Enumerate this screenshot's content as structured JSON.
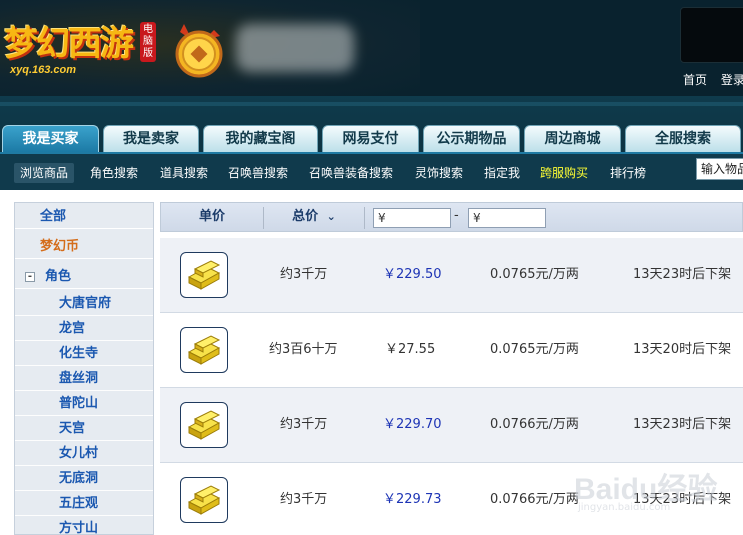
{
  "header": {
    "logo_main": "梦幻西游",
    "logo_tag": "电脑版",
    "logo_url": "xyq.163.com",
    "top_links": [
      "首页",
      "登录"
    ]
  },
  "main_tabs": [
    {
      "label": "我是买家",
      "active": true
    },
    {
      "label": "我是卖家",
      "active": false
    },
    {
      "label": "我的藏宝阁",
      "active": false
    },
    {
      "label": "网易支付",
      "active": false
    },
    {
      "label": "公示期物品",
      "active": false
    },
    {
      "label": "周边商城",
      "active": false
    },
    {
      "label": "全服搜索",
      "active": false
    }
  ],
  "sub_nav": [
    {
      "label": "浏览商品",
      "active": true
    },
    {
      "label": "角色搜索"
    },
    {
      "label": "道具搜索"
    },
    {
      "label": "召唤兽搜索"
    },
    {
      "label": "召唤兽装备搜索"
    },
    {
      "label": "灵饰搜索"
    },
    {
      "label": "指定我"
    },
    {
      "label": "跨服购买",
      "highlight": true
    },
    {
      "label": "排行榜"
    }
  ],
  "sub_search_placeholder": "输入物品",
  "sidebar": {
    "items": [
      "全部",
      "梦幻币"
    ],
    "category": "角色",
    "schools": [
      "大唐官府",
      "龙宫",
      "化生寺",
      "盘丝洞",
      "普陀山",
      "天宫",
      "女儿村",
      "无底洞",
      "五庄观",
      "方寸山"
    ]
  },
  "list_header": {
    "unit_price": "单价",
    "total_price": "总价",
    "sort_arrow": "⌄",
    "min_value": "¥",
    "range_dash": "-",
    "max_value": "¥"
  },
  "rows": [
    {
      "amount": "约3千万",
      "price": "￥229.50",
      "rate": "0.0765元/万两",
      "time_left": "13天23时后下架"
    },
    {
      "amount": "约3百6十万",
      "price": "￥27.55",
      "rate": "0.0765元/万两",
      "time_left": "13天20时后下架"
    },
    {
      "amount": "约3千万",
      "price": "￥229.70",
      "rate": "0.0766元/万两",
      "time_left": "13天23时后下架"
    },
    {
      "amount": "约3千万",
      "price": "￥229.73",
      "rate": "0.0766元/万两",
      "time_left": "13天23时后下架"
    }
  ],
  "watermark": {
    "main": "Baidu经验",
    "sub": "jingyan.baidu.com"
  },
  "colors": {
    "header_bg": "#09222e",
    "tab_active": "#1c7aa5",
    "price_blue": "#1d34b5",
    "side_link": "#1b58b0",
    "side_orange": "#d46d1b"
  }
}
